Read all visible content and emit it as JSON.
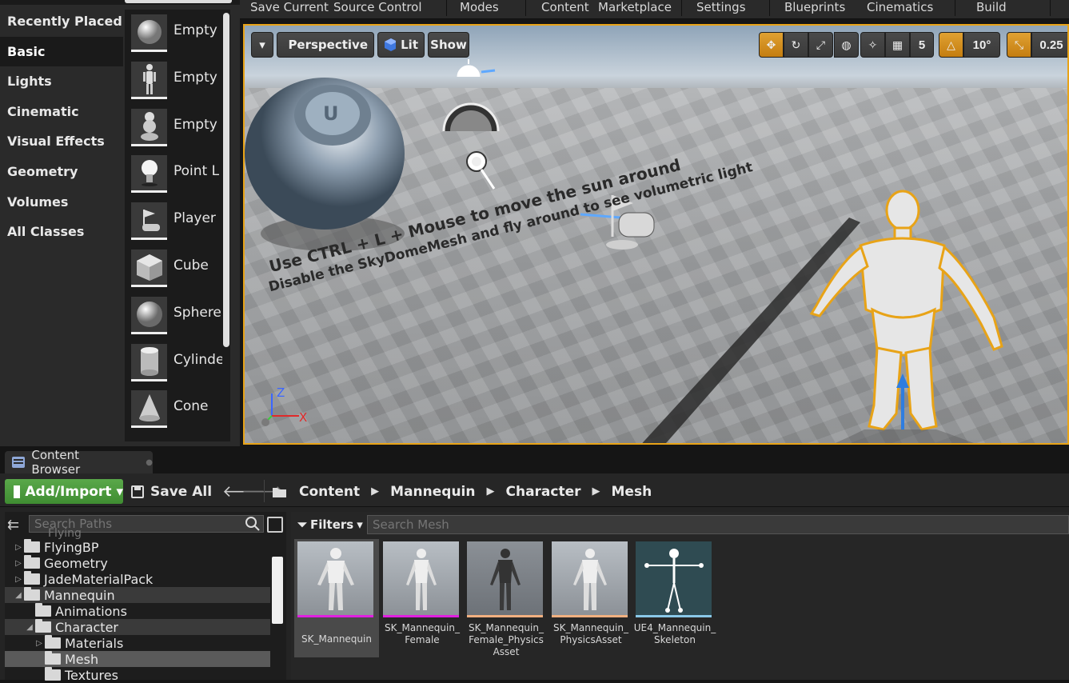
{
  "place_panel": {
    "categories": [
      "Recently Placed",
      "Basic",
      "Lights",
      "Cinematic",
      "Visual Effects",
      "Geometry",
      "Volumes",
      "All Classes"
    ],
    "selected_category": "Basic",
    "assets": [
      {
        "label": "Empty",
        "icon": "sphere-icon"
      },
      {
        "label": "Empty",
        "icon": "character-icon"
      },
      {
        "label": "Empty",
        "icon": "pawn-icon"
      },
      {
        "label": "Point L",
        "icon": "light-bulb-icon"
      },
      {
        "label": "Player",
        "icon": "player-start-icon"
      },
      {
        "label": "Cube",
        "icon": "cube-icon"
      },
      {
        "label": "Sphere",
        "icon": "sphere-icon"
      },
      {
        "label": "Cylinde",
        "icon": "cylinder-icon"
      },
      {
        "label": "Cone",
        "icon": "cone-icon"
      }
    ]
  },
  "toolbar": {
    "items": [
      "Save Current",
      "Source Control",
      "Modes",
      "Content",
      "Marketplace",
      "Settings",
      "Blueprints",
      "Cinematics",
      "Build"
    ]
  },
  "viewport": {
    "perspective_label": "Perspective",
    "lit_label": "Lit",
    "show_label": "Show",
    "grid_snap_value": "5",
    "rotation_snap_value": "10°",
    "scale_snap_value": "0.25",
    "hint_line_1": "Use CTRL + L + Mouse to move the sun around",
    "hint_line_2": "Disable the SkyDomeMesh and fly around to see volumetric light",
    "axis_z": "Z",
    "axis_x": "X",
    "accent_color": "#e8a317"
  },
  "content_browser": {
    "tab_label": "Content Browser",
    "add_import_label": "Add/Import",
    "save_all_label": "Save All",
    "breadcrumb": [
      "Content",
      "Mannequin",
      "Character",
      "Mesh"
    ],
    "path_search_placeholder": "Search Paths",
    "filters_label": "Filters",
    "mesh_search_placeholder": "Search Mesh",
    "tree": [
      {
        "label": "FlyingBP",
        "depth": 0,
        "expanded": false
      },
      {
        "label": "Geometry",
        "depth": 0,
        "expanded": false
      },
      {
        "label": "JadeMaterialPack",
        "depth": 0,
        "expanded": false
      },
      {
        "label": "Mannequin",
        "depth": 0,
        "expanded": true
      },
      {
        "label": "Animations",
        "depth": 1,
        "expanded": null
      },
      {
        "label": "Character",
        "depth": 1,
        "expanded": true
      },
      {
        "label": "Materials",
        "depth": 2,
        "expanded": false
      },
      {
        "label": "Mesh",
        "depth": 2,
        "expanded": null
      },
      {
        "label": "Textures",
        "depth": 2,
        "expanded": null
      }
    ],
    "assets": [
      {
        "label": "SK_Mannequin",
        "bar_color": "#e020e0"
      },
      {
        "label": "SK_Mannequin_\nFemale",
        "bar_color": "#e020e0"
      },
      {
        "label": "SK_Mannequin_\nFemale_Physics\nAsset",
        "bar_color": "#f0b080"
      },
      {
        "label": "SK_Mannequin_\nPhysicsAsset",
        "bar_color": "#f0b080"
      },
      {
        "label": "UE4_Mannequin_\nSkeleton",
        "bar_color": "#8ac8e8"
      }
    ]
  }
}
